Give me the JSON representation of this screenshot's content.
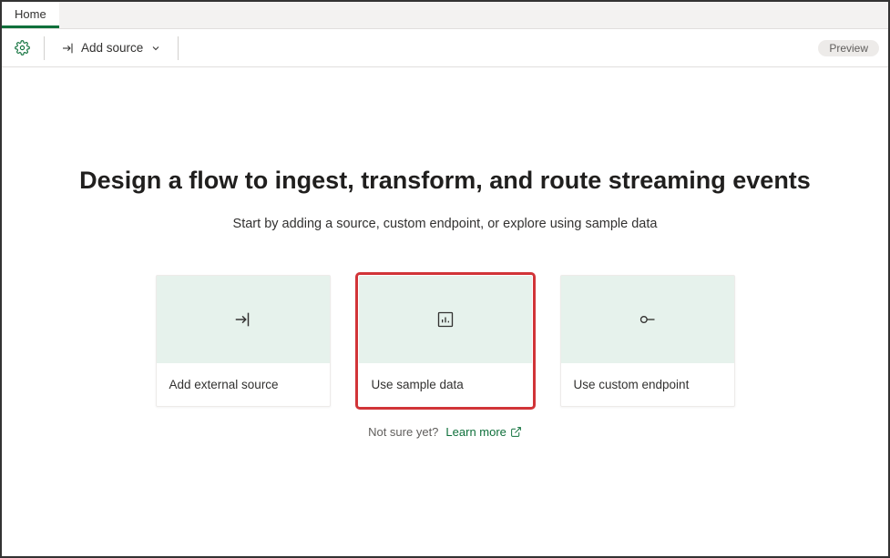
{
  "tabs": {
    "home": "Home"
  },
  "toolbar": {
    "add_source_label": "Add source",
    "preview_badge": "Preview"
  },
  "hero": {
    "title": "Design a flow to ingest, transform, and route streaming events",
    "subtitle": "Start by adding a source, custom endpoint, or explore using sample data"
  },
  "cards": {
    "external": "Add external source",
    "sample": "Use sample data",
    "endpoint": "Use custom endpoint"
  },
  "footer": {
    "not_sure": "Not sure yet?",
    "learn_more": "Learn more"
  }
}
